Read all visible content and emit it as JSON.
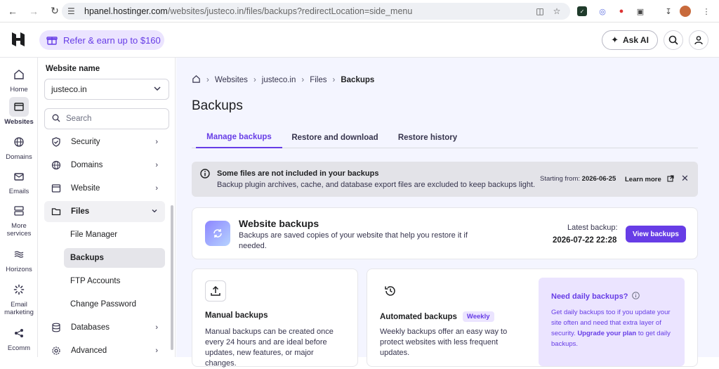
{
  "browser": {
    "url_host": "hpanel.hostinger.com",
    "url_path": "/websites/justeco.in/files/backups?redirectLocation=side_menu"
  },
  "topbar": {
    "refer_label": "Refer & earn up to $160",
    "ask_ai_label": "Ask AI"
  },
  "rail": {
    "items": [
      {
        "label": "Home",
        "icon": "home-icon"
      },
      {
        "label": "Websites",
        "icon": "websites-icon",
        "active": true
      },
      {
        "label": "Domains",
        "icon": "globe-icon"
      },
      {
        "label": "Emails",
        "icon": "mail-icon"
      },
      {
        "label": "More",
        "label2": "services",
        "icon": "server-icon"
      },
      {
        "label": "Horizons",
        "icon": "horizons-icon"
      },
      {
        "label": "Email",
        "label2": "marketing",
        "icon": "marketing-icon"
      },
      {
        "label": "Ecomm",
        "icon": "share-icon"
      }
    ]
  },
  "sidebar": {
    "website_label": "Website name",
    "website_value": "justeco.in",
    "search_placeholder": "Search",
    "menu": [
      {
        "label": "Security",
        "icon": "shield-icon"
      },
      {
        "label": "Domains",
        "icon": "globe-icon"
      },
      {
        "label": "Website",
        "icon": "browser-icon"
      },
      {
        "label": "Files",
        "icon": "folder-icon",
        "open": true
      },
      {
        "label": "Databases",
        "icon": "database-icon"
      },
      {
        "label": "Advanced",
        "icon": "gear-icon"
      }
    ],
    "files_sub": [
      "File Manager",
      "Backups",
      "FTP Accounts",
      "Change Password"
    ]
  },
  "breadcrumb": {
    "items": [
      "Websites",
      "justeco.in",
      "Files"
    ],
    "current": "Backups"
  },
  "page_title": "Backups",
  "tabs": [
    "Manage backups",
    "Restore and download",
    "Restore history"
  ],
  "alert": {
    "title": "Some files are not included in your backups",
    "desc": "Backup plugin archives, cache, and database export files are excluded to keep backups light.",
    "start_label": "Starting from:",
    "start_date": "2026-06-25",
    "learn_more": "Learn more"
  },
  "website_backups": {
    "title": "Website backups",
    "desc": "Backups are saved copies of your website that help you restore it if needed.",
    "latest_label": "Latest backup:",
    "latest_value": "2026-07-22 22:28",
    "button": "View backups"
  },
  "manual": {
    "title": "Manual backups",
    "desc": "Manual backups can be created once every 24 hours and are ideal before updates, new features, or major changes."
  },
  "automated": {
    "title": "Automated backups",
    "badge": "Weekly",
    "desc": "Weekly backups offer an easy way to protect websites with less frequent updates."
  },
  "promo": {
    "title": "Need daily backups?",
    "desc_pre": "Get daily backups too if you update your site often and need that extra layer of security.",
    "link": "Upgrade your plan",
    "desc_post": "to get daily backups."
  },
  "colors": {
    "accent": "#673de6",
    "accent_light": "#ebe4ff",
    "main_bg": "#f4f5ff"
  }
}
